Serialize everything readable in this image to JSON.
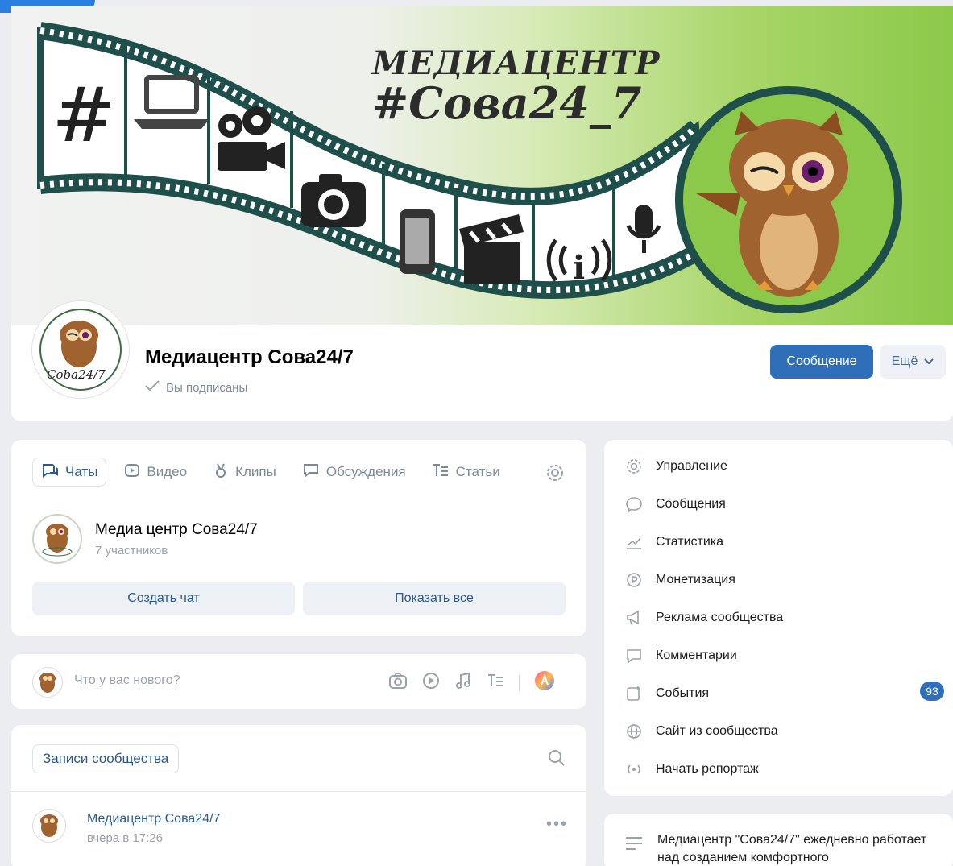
{
  "cover": {
    "title_line1": "МЕДИАЦЕНТР",
    "title_line2": "#Сова24_7",
    "icons": [
      "hashtag-icon",
      "laptop-icon",
      "video-camera-icon",
      "photo-camera-icon",
      "smartphone-icon",
      "clapperboard-icon",
      "info-broadcast-icon",
      "microphone-icon",
      "owl-mascot"
    ]
  },
  "header": {
    "avatar_caption": "Coba24/7",
    "group_name": "Медиацентр Сова24/7",
    "subscribed": "Вы подписаны",
    "message_button": "Сообщение",
    "more_button": "Ещё"
  },
  "tabs": {
    "chats": "Чаты",
    "video": "Видео",
    "clips": "Клипы",
    "discussions": "Обсуждения",
    "articles": "Статьи"
  },
  "chat": {
    "title": "Медиа центр Сова24/7",
    "members": "7 участников",
    "create_button": "Создать чат",
    "show_all_button": "Показать все"
  },
  "composer": {
    "placeholder": "Что у вас нового?"
  },
  "posts": {
    "tab_label": "Записи сообщества",
    "author": "Медиацентр Сова24/7",
    "time": "вчера в 17:26",
    "more": "•••"
  },
  "menu": {
    "items": [
      {
        "label": "Управление",
        "icon": "gear-icon"
      },
      {
        "label": "Сообщения",
        "icon": "message-icon"
      },
      {
        "label": "Статистика",
        "icon": "chart-icon"
      },
      {
        "label": "Монетизация",
        "icon": "coin-icon"
      },
      {
        "label": "Реклама сообщества",
        "icon": "megaphone-icon"
      },
      {
        "label": "Комментарии",
        "icon": "comment-icon"
      },
      {
        "label": "События",
        "icon": "event-icon"
      },
      {
        "label": "Сайт из сообщества",
        "icon": "globe-icon"
      },
      {
        "label": "Начать репортаж",
        "icon": "broadcast-icon"
      }
    ],
    "events_badge": "93"
  },
  "about": {
    "text": "Медиацентр \"Сова24/7\" ежедневно работает над созданием комфортного"
  },
  "colors": {
    "accent": "#2f6fba",
    "link": "#2c5a8f",
    "muted": "#99a2ad",
    "film": "#1f4f4b"
  }
}
